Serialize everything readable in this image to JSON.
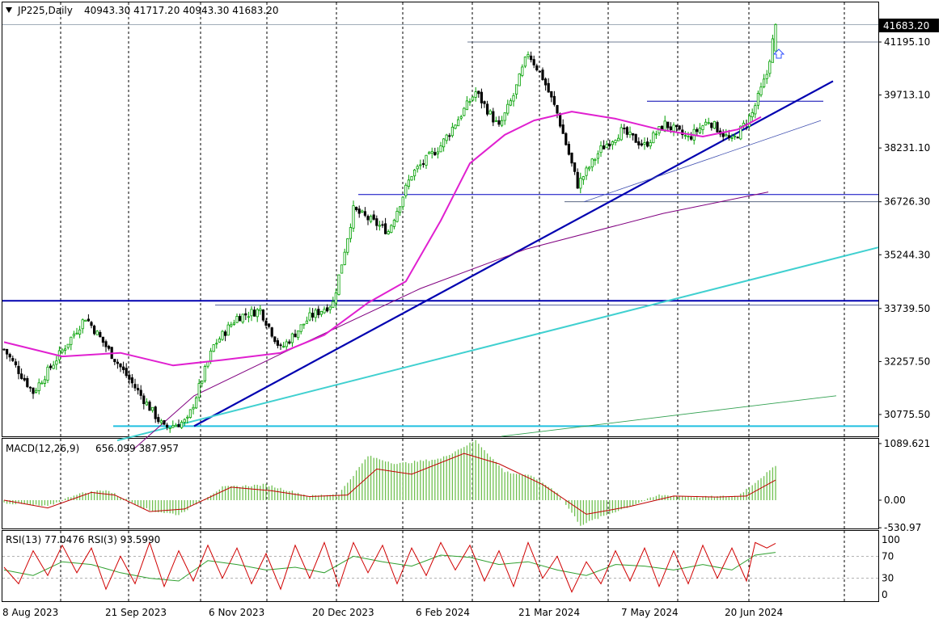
{
  "header": {
    "symbol": "JP225,Daily",
    "ohlc": "40943.30 41717.20 40943.30 41683.20",
    "last_price": "41683.20"
  },
  "colors": {
    "bull": "#00a000",
    "bear": "#000000",
    "ma_fast": "#e020d0",
    "ma_slow": "#800080",
    "trend_main": "#0000b0",
    "trend_cyan": "#40d0d0",
    "trend_green": "#30a050",
    "macd_hist": "#70c050",
    "macd_signal": "#c00000",
    "rsi13": "#30a030",
    "rsi3": "#d00000",
    "arrow": "#3050ff"
  },
  "icons": {
    "menu": "triangle-down-icon",
    "marker": "up-arrow-icon"
  },
  "chart_data": [
    {
      "type": "candlestick",
      "title": "JP225,Daily",
      "ylim": [
        29800,
        42400
      ],
      "y_ticks": [
        "41195.10",
        "39713.10",
        "38231.10",
        "36726.30",
        "35244.30",
        "33739.50",
        "32257.50",
        "30775.50"
      ],
      "x_ticks": [
        "8 Aug 2023",
        "21 Sep 2023",
        "6 Nov 2023",
        "20 Dec 2023",
        "6 Feb 2024",
        "21 Mar 2024",
        "7 May 2024",
        "20 Jun 2024"
      ],
      "key_closes": [
        {
          "bar": 0,
          "close": 32600
        },
        {
          "bar": 10,
          "close": 31400
        },
        {
          "bar": 28,
          "close": 33500
        },
        {
          "bar": 40,
          "close": 32100
        },
        {
          "bar": 55,
          "close": 30400
        },
        {
          "bar": 63,
          "close": 30600
        },
        {
          "bar": 72,
          "close": 32700
        },
        {
          "bar": 80,
          "close": 33500
        },
        {
          "bar": 88,
          "close": 33700
        },
        {
          "bar": 95,
          "close": 32600
        },
        {
          "bar": 105,
          "close": 33500
        },
        {
          "bar": 113,
          "close": 33900
        },
        {
          "bar": 120,
          "close": 36500
        },
        {
          "bar": 132,
          "close": 35900
        },
        {
          "bar": 140,
          "close": 37500
        },
        {
          "bar": 150,
          "close": 38300
        },
        {
          "bar": 162,
          "close": 39800
        },
        {
          "bar": 170,
          "close": 38800
        },
        {
          "bar": 175,
          "close": 39700
        },
        {
          "bar": 180,
          "close": 40900
        },
        {
          "bar": 185,
          "close": 40200
        },
        {
          "bar": 190,
          "close": 39200
        },
        {
          "bar": 197,
          "close": 37200
        },
        {
          "bar": 205,
          "close": 38200
        },
        {
          "bar": 212,
          "close": 38700
        },
        {
          "bar": 220,
          "close": 38300
        },
        {
          "bar": 227,
          "close": 38900
        },
        {
          "bar": 235,
          "close": 38500
        },
        {
          "bar": 242,
          "close": 39000
        },
        {
          "bar": 250,
          "close": 38400
        },
        {
          "bar": 257,
          "close": 39200
        },
        {
          "bar": 262,
          "close": 40300
        },
        {
          "bar": 265,
          "close": 41683
        }
      ],
      "ma_fast_points": [
        {
          "bar": 0,
          "value": 32800
        },
        {
          "bar": 20,
          "value": 32400
        },
        {
          "bar": 40,
          "value": 32500
        },
        {
          "bar": 58,
          "value": 32150
        },
        {
          "bar": 75,
          "value": 32300
        },
        {
          "bar": 95,
          "value": 32500
        },
        {
          "bar": 110,
          "value": 33000
        },
        {
          "bar": 125,
          "value": 33900
        },
        {
          "bar": 138,
          "value": 34500
        },
        {
          "bar": 150,
          "value": 36200
        },
        {
          "bar": 160,
          "value": 37800
        },
        {
          "bar": 172,
          "value": 38600
        },
        {
          "bar": 182,
          "value": 39000
        },
        {
          "bar": 195,
          "value": 39250
        },
        {
          "bar": 210,
          "value": 39050
        },
        {
          "bar": 225,
          "value": 38750
        },
        {
          "bar": 240,
          "value": 38550
        },
        {
          "bar": 252,
          "value": 38750
        },
        {
          "bar": 260,
          "value": 39100
        }
      ],
      "ma_slow_points": [
        {
          "bar": 35,
          "value": 29800
        },
        {
          "bar": 70,
          "value": 31300
        },
        {
          "bar": 110,
          "value": 32500
        },
        {
          "bar": 150,
          "value": 34300
        },
        {
          "bar": 190,
          "value": 35400
        },
        {
          "bar": 230,
          "value": 36400
        },
        {
          "bar": 263,
          "value": 37000
        }
      ],
      "levels": [
        {
          "name": "top",
          "value": 41683.2
        },
        {
          "name": "resistance-high",
          "value": 41195.1
        },
        {
          "name": "range-top",
          "value": 39540
        },
        {
          "name": "support",
          "value": 36930
        },
        {
          "name": "support-thin",
          "value": 36726.3
        },
        {
          "name": "breakout",
          "value": 33955
        },
        {
          "name": "base",
          "value": 30450
        }
      ],
      "trendlines": [
        {
          "name": "main",
          "from": [
            0,
            30450
          ],
          "to": [
            288,
            40100
          ]
        },
        {
          "name": "thin",
          "from": [
            200,
            36726
          ],
          "to": [
            277,
            39050
          ]
        },
        {
          "name": "cyan",
          "from": [
            0,
            30050
          ],
          "to": [
            320,
            35450
          ]
        },
        {
          "name": "green",
          "from": [
            130,
            29800
          ],
          "to": [
            280,
            31300
          ]
        }
      ]
    },
    {
      "type": "bar",
      "title": "MACD(12,26,9)",
      "values_label": "656.099 387.957",
      "ylim": [
        -650,
        1250
      ],
      "y_ticks": [
        "1089.621",
        "0.00",
        "-530.97"
      ],
      "hist_points": [
        {
          "bar": 0,
          "value": -50
        },
        {
          "bar": 15,
          "value": -120
        },
        {
          "bar": 25,
          "value": 120
        },
        {
          "bar": 35,
          "value": 200
        },
        {
          "bar": 50,
          "value": -200
        },
        {
          "bar": 60,
          "value": -280
        },
        {
          "bar": 75,
          "value": 250
        },
        {
          "bar": 90,
          "value": 300
        },
        {
          "bar": 105,
          "value": 80
        },
        {
          "bar": 115,
          "value": 120
        },
        {
          "bar": 125,
          "value": 850
        },
        {
          "bar": 135,
          "value": 700
        },
        {
          "bar": 150,
          "value": 800
        },
        {
          "bar": 162,
          "value": 1150
        },
        {
          "bar": 172,
          "value": 550
        },
        {
          "bar": 182,
          "value": 450
        },
        {
          "bar": 190,
          "value": 150
        },
        {
          "bar": 198,
          "value": -480
        },
        {
          "bar": 210,
          "value": -220
        },
        {
          "bar": 225,
          "value": 100
        },
        {
          "bar": 240,
          "value": 60
        },
        {
          "bar": 252,
          "value": 80
        },
        {
          "bar": 265,
          "value": 656
        }
      ],
      "signal_points": [
        {
          "bar": 0,
          "value": 0
        },
        {
          "bar": 15,
          "value": -150
        },
        {
          "bar": 30,
          "value": 150
        },
        {
          "bar": 38,
          "value": 100
        },
        {
          "bar": 50,
          "value": -220
        },
        {
          "bar": 62,
          "value": -170
        },
        {
          "bar": 78,
          "value": 250
        },
        {
          "bar": 92,
          "value": 180
        },
        {
          "bar": 105,
          "value": 70
        },
        {
          "bar": 118,
          "value": 100
        },
        {
          "bar": 128,
          "value": 600
        },
        {
          "bar": 140,
          "value": 500
        },
        {
          "bar": 158,
          "value": 900
        },
        {
          "bar": 170,
          "value": 700
        },
        {
          "bar": 185,
          "value": 300
        },
        {
          "bar": 200,
          "value": -270
        },
        {
          "bar": 215,
          "value": -120
        },
        {
          "bar": 230,
          "value": 80
        },
        {
          "bar": 245,
          "value": 60
        },
        {
          "bar": 255,
          "value": 80
        },
        {
          "bar": 265,
          "value": 388
        }
      ]
    },
    {
      "type": "line",
      "title": "RSI",
      "values_label": "RSI(13) 77.0476  RSI(3) 93.5990",
      "ylim": [
        0,
        100
      ],
      "y_ticks": [
        "100",
        "70",
        "30",
        "0"
      ],
      "rsi13_points": [
        {
          "bar": 0,
          "value": 45
        },
        {
          "bar": 10,
          "value": 35
        },
        {
          "bar": 20,
          "value": 60
        },
        {
          "bar": 30,
          "value": 55
        },
        {
          "bar": 40,
          "value": 40
        },
        {
          "bar": 50,
          "value": 30
        },
        {
          "bar": 60,
          "value": 25
        },
        {
          "bar": 70,
          "value": 62
        },
        {
          "bar": 80,
          "value": 55
        },
        {
          "bar": 90,
          "value": 45
        },
        {
          "bar": 100,
          "value": 50
        },
        {
          "bar": 110,
          "value": 40
        },
        {
          "bar": 120,
          "value": 70
        },
        {
          "bar": 130,
          "value": 60
        },
        {
          "bar": 140,
          "value": 52
        },
        {
          "bar": 150,
          "value": 72
        },
        {
          "bar": 160,
          "value": 68
        },
        {
          "bar": 170,
          "value": 55
        },
        {
          "bar": 180,
          "value": 60
        },
        {
          "bar": 190,
          "value": 45
        },
        {
          "bar": 200,
          "value": 35
        },
        {
          "bar": 210,
          "value": 55
        },
        {
          "bar": 220,
          "value": 52
        },
        {
          "bar": 230,
          "value": 45
        },
        {
          "bar": 240,
          "value": 55
        },
        {
          "bar": 250,
          "value": 45
        },
        {
          "bar": 258,
          "value": 72
        },
        {
          "bar": 265,
          "value": 77
        }
      ],
      "rsi3_points": [
        {
          "bar": 0,
          "value": 50
        },
        {
          "bar": 5,
          "value": 20
        },
        {
          "bar": 10,
          "value": 80
        },
        {
          "bar": 15,
          "value": 35
        },
        {
          "bar": 20,
          "value": 90
        },
        {
          "bar": 25,
          "value": 40
        },
        {
          "bar": 30,
          "value": 85
        },
        {
          "bar": 35,
          "value": 10
        },
        {
          "bar": 40,
          "value": 70
        },
        {
          "bar": 45,
          "value": 20
        },
        {
          "bar": 50,
          "value": 95
        },
        {
          "bar": 55,
          "value": 15
        },
        {
          "bar": 60,
          "value": 80
        },
        {
          "bar": 65,
          "value": 25
        },
        {
          "bar": 70,
          "value": 90
        },
        {
          "bar": 75,
          "value": 30
        },
        {
          "bar": 80,
          "value": 85
        },
        {
          "bar": 85,
          "value": 20
        },
        {
          "bar": 90,
          "value": 75
        },
        {
          "bar": 95,
          "value": 10
        },
        {
          "bar": 100,
          "value": 90
        },
        {
          "bar": 105,
          "value": 30
        },
        {
          "bar": 110,
          "value": 95
        },
        {
          "bar": 115,
          "value": 15
        },
        {
          "bar": 120,
          "value": 95
        },
        {
          "bar": 125,
          "value": 40
        },
        {
          "bar": 130,
          "value": 90
        },
        {
          "bar": 135,
          "value": 20
        },
        {
          "bar": 140,
          "value": 85
        },
        {
          "bar": 145,
          "value": 35
        },
        {
          "bar": 150,
          "value": 95
        },
        {
          "bar": 155,
          "value": 45
        },
        {
          "bar": 160,
          "value": 90
        },
        {
          "bar": 165,
          "value": 25
        },
        {
          "bar": 170,
          "value": 80
        },
        {
          "bar": 175,
          "value": 15
        },
        {
          "bar": 180,
          "value": 95
        },
        {
          "bar": 185,
          "value": 30
        },
        {
          "bar": 190,
          "value": 70
        },
        {
          "bar": 195,
          "value": 5
        },
        {
          "bar": 200,
          "value": 60
        },
        {
          "bar": 205,
          "value": 20
        },
        {
          "bar": 210,
          "value": 80
        },
        {
          "bar": 215,
          "value": 25
        },
        {
          "bar": 220,
          "value": 85
        },
        {
          "bar": 225,
          "value": 15
        },
        {
          "bar": 230,
          "value": 80
        },
        {
          "bar": 235,
          "value": 20
        },
        {
          "bar": 240,
          "value": 90
        },
        {
          "bar": 245,
          "value": 30
        },
        {
          "bar": 250,
          "value": 85
        },
        {
          "bar": 255,
          "value": 25
        },
        {
          "bar": 258,
          "value": 95
        },
        {
          "bar": 262,
          "value": 85
        },
        {
          "bar": 265,
          "value": 93.6
        }
      ]
    }
  ]
}
